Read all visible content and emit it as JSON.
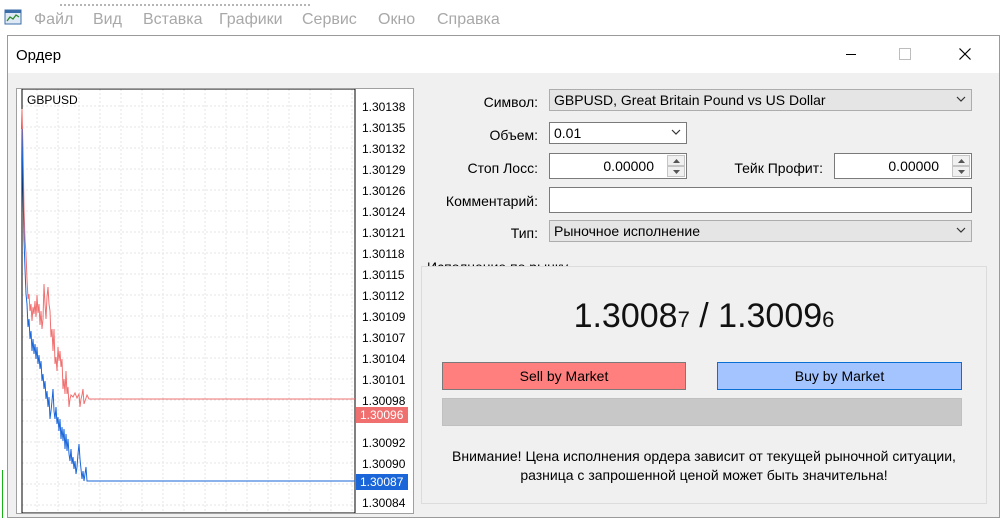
{
  "app_menu": [
    "Файл",
    "Вид",
    "Вставка",
    "Графики",
    "Сервис",
    "Окно",
    "Справка"
  ],
  "dialog": {
    "title": "Ордер"
  },
  "chart": {
    "symbol": "GBPUSD",
    "price_levels": [
      "1.30138",
      "1.30135",
      "1.30132",
      "1.30129",
      "1.30126",
      "1.30124",
      "1.30121",
      "1.30118",
      "1.30115",
      "1.30112",
      "1.30109",
      "1.30107",
      "1.30104",
      "1.30101",
      "1.30098",
      "1.30092",
      "1.30090",
      "1.30084"
    ],
    "ask_tag": "1.30096",
    "bid_tag": "1.30087",
    "ask_color": "#f07070",
    "bid_color": "#1a66d9",
    "grid": true
  },
  "form": {
    "symbol_label": "Символ:",
    "symbol_value": "GBPUSD, Great Britain Pound vs US Dollar",
    "volume_label": "Объем:",
    "volume_value": "0.01",
    "sl_label": "Стоп Лосс:",
    "sl_value": "0.00000",
    "tp_label": "Тейк Профит:",
    "tp_value": "0.00000",
    "comment_label": "Комментарий:",
    "comment_value": "",
    "type_label": "Тип:",
    "type_value": "Рыночное исполнение"
  },
  "execution": {
    "group_label": "Исполнение по рынку",
    "bid_main": "1.3008",
    "bid_last": "7",
    "separator": " / ",
    "ask_main": "1.3009",
    "ask_last": "6",
    "sell_label": "Sell by Market",
    "buy_label": "Buy by Market",
    "sell_color": "#ff7f7f",
    "buy_color": "#a3c4ff",
    "warning_line1": "Внимание! Цена исполнения ордера зависит от текущей рыночной ситуации,",
    "warning_line2": "разница с запрошенной ценой может быть значительна!"
  }
}
